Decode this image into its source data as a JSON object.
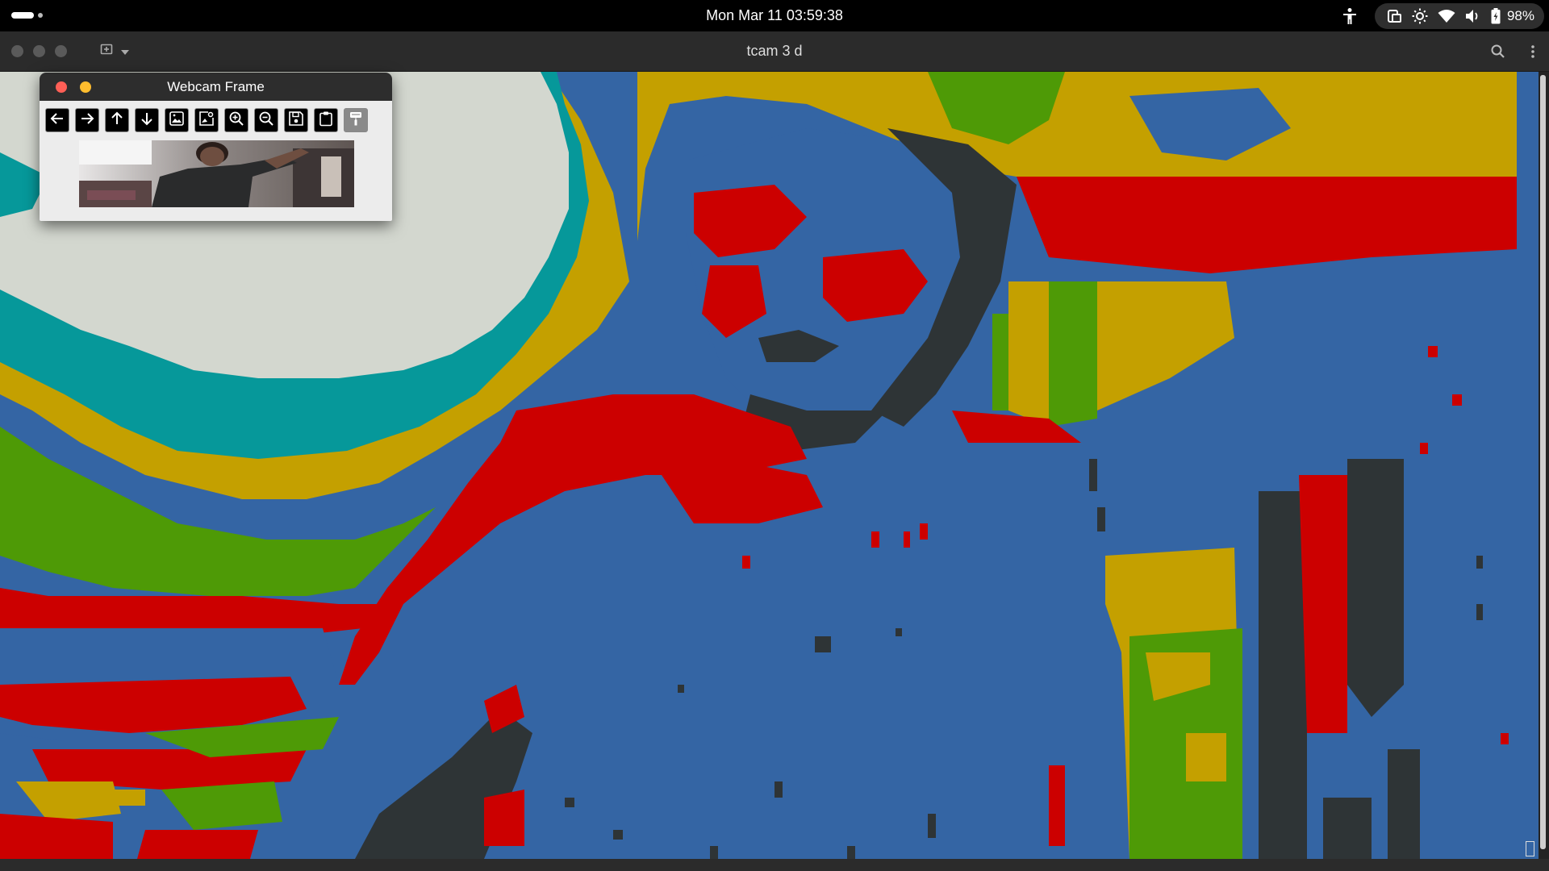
{
  "topbar": {
    "clock": "Mon Mar 11  03:59:38",
    "battery_percent": "98%",
    "icons": [
      "accessibility-icon",
      "screen-rotation-icon",
      "brightness-icon",
      "wifi-icon",
      "volume-icon",
      "battery-icon"
    ]
  },
  "window": {
    "title": "tcam 3 d",
    "header_icons": [
      "new-tab-icon",
      "dropdown-arrow-icon",
      "search-icon",
      "kebab-menu-icon"
    ]
  },
  "webcam_window": {
    "title": "Webcam Frame",
    "toolbar_buttons": [
      {
        "name": "back",
        "icon": "arrow-left-icon",
        "enabled": true
      },
      {
        "name": "forward",
        "icon": "arrow-right-icon",
        "enabled": true
      },
      {
        "name": "up",
        "icon": "arrow-up-icon",
        "enabled": true
      },
      {
        "name": "down",
        "icon": "arrow-down-icon",
        "enabled": true
      },
      {
        "name": "image",
        "icon": "image-icon",
        "enabled": true
      },
      {
        "name": "image-edit",
        "icon": "image-settings-icon",
        "enabled": true
      },
      {
        "name": "zoom-in",
        "icon": "zoom-in-icon",
        "enabled": true
      },
      {
        "name": "zoom-out",
        "icon": "zoom-out-icon",
        "enabled": true
      },
      {
        "name": "save",
        "icon": "save-icon",
        "enabled": true
      },
      {
        "name": "clipboard",
        "icon": "clipboard-icon",
        "enabled": true
      },
      {
        "name": "paint",
        "icon": "paint-roller-icon",
        "enabled": false
      }
    ]
  },
  "palette": {
    "blue": "#3465a4",
    "red": "#cc0000",
    "yellow": "#c4a000",
    "green": "#4e9a06",
    "teal": "#06989a",
    "white": "#d3d7cf",
    "dark": "#2e3436"
  }
}
